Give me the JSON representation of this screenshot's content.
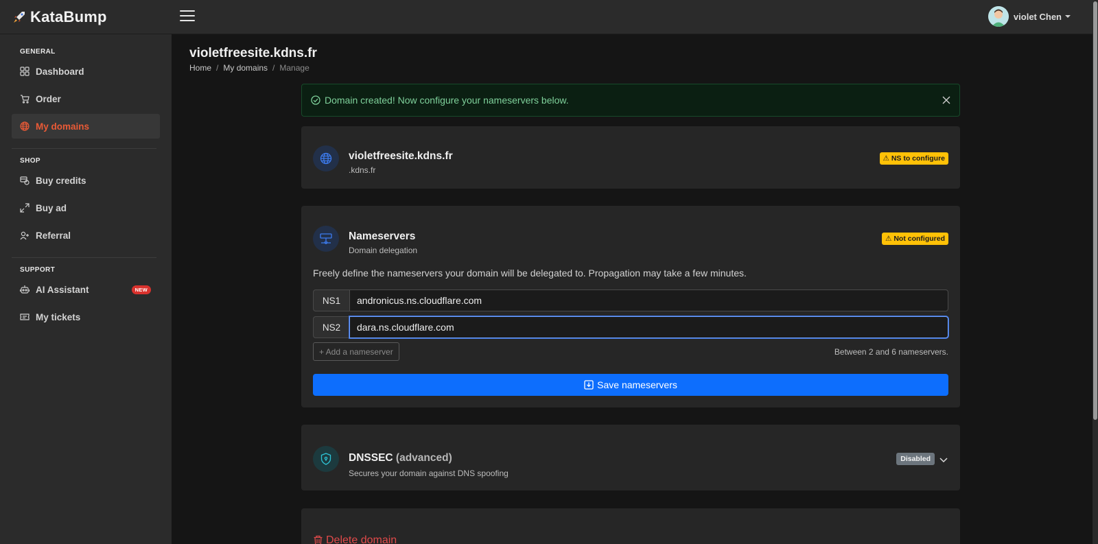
{
  "header": {
    "brand": "KataBump",
    "user_name": "violet Chen"
  },
  "sidebar": {
    "sections": [
      {
        "title": "GENERAL",
        "items": [
          {
            "label": "Dashboard",
            "icon": "grid-icon"
          },
          {
            "label": "Order",
            "icon": "cart-icon"
          },
          {
            "label": "My domains",
            "icon": "globe-icon",
            "active": true
          }
        ]
      },
      {
        "title": "SHOP",
        "items": [
          {
            "label": "Buy credits",
            "icon": "credits-icon"
          },
          {
            "label": "Buy ad",
            "icon": "expand-icon"
          },
          {
            "label": "Referral",
            "icon": "user-plus-icon"
          }
        ]
      },
      {
        "title": "SUPPORT",
        "items": [
          {
            "label": "AI Assistant",
            "icon": "robot-icon",
            "badge": "NEW"
          },
          {
            "label": "My tickets",
            "icon": "ticket-icon"
          }
        ]
      }
    ],
    "active_color": "#ea5a36"
  },
  "page": {
    "title": "violetfreesite.kdns.fr",
    "breadcrumb": [
      "Home",
      "My domains",
      "Manage"
    ]
  },
  "alert": {
    "text": "Domain created! Now configure your nameservers below."
  },
  "domain_card": {
    "name": "violetfreesite.kdns.fr",
    "tld": ".kdns.fr",
    "badge": "⚠ NS to configure"
  },
  "nameservers": {
    "title": "Nameservers",
    "subtitle": "Domain delegation",
    "badge": "⚠ Not configured",
    "description": "Freely define the nameservers your domain will be delegated to. Propagation may take a few minutes.",
    "rows": [
      {
        "label": "NS1",
        "value": "andronicus.ns.cloudflare.com"
      },
      {
        "label": "NS2",
        "value": "dara.ns.cloudflare.com"
      }
    ],
    "add_label": "+ Add a nameserver",
    "hint": "Between 2 and 6 nameservers.",
    "save_label": "Save nameservers"
  },
  "dnssec": {
    "title": "DNSSEC",
    "title_suffix": "(advanced)",
    "subtitle": "Secures your domain against DNS spoofing",
    "badge": "Disabled"
  },
  "delete": {
    "label": "Delete domain"
  },
  "colors": {
    "primary": "#0d6efd",
    "warning": "#ffc107",
    "danger": "#e04a4a",
    "success_text": "#7fd19b"
  }
}
